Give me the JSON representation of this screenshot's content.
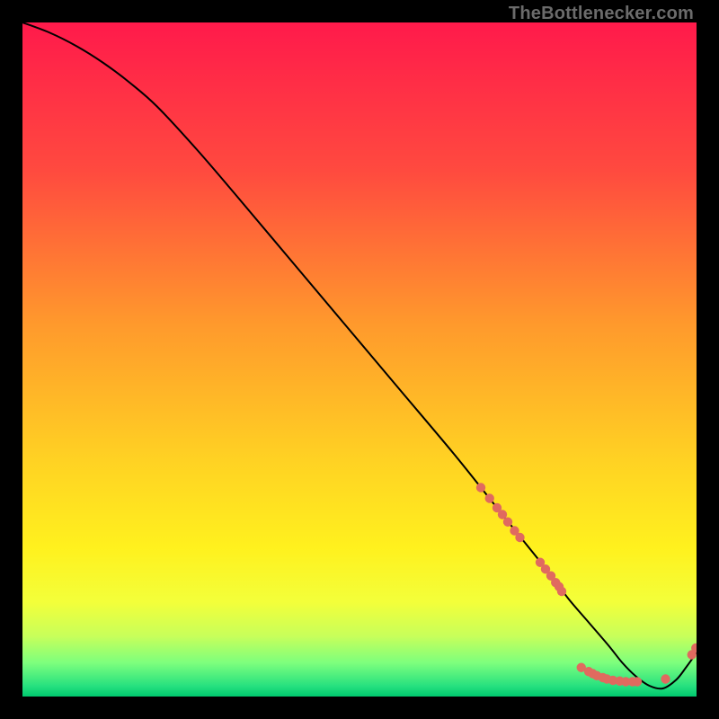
{
  "watermark": "TheBottlenecker.com",
  "chart_data": {
    "type": "line",
    "title": "",
    "xlabel": "",
    "ylabel": "",
    "xlim": [
      0,
      100
    ],
    "ylim": [
      0,
      100
    ],
    "grid": false,
    "legend": false,
    "background_gradient": {
      "stops": [
        {
          "offset": 0.0,
          "color": "#ff1a4b"
        },
        {
          "offset": 0.22,
          "color": "#ff4a3f"
        },
        {
          "offset": 0.45,
          "color": "#ff9a2c"
        },
        {
          "offset": 0.65,
          "color": "#ffd223"
        },
        {
          "offset": 0.78,
          "color": "#fff11e"
        },
        {
          "offset": 0.86,
          "color": "#f3ff3a"
        },
        {
          "offset": 0.91,
          "color": "#c8ff5a"
        },
        {
          "offset": 0.95,
          "color": "#7dff7d"
        },
        {
          "offset": 0.985,
          "color": "#25e07f"
        },
        {
          "offset": 1.0,
          "color": "#00c86e"
        }
      ]
    },
    "series": [
      {
        "name": "bottleneck-curve",
        "color": "#000000",
        "x": [
          0,
          4,
          8,
          12,
          16,
          20,
          26,
          32,
          40,
          48,
          56,
          64,
          70,
          74,
          78,
          81,
          84,
          87,
          89,
          91,
          93,
          95,
          97,
          98.5,
          100
        ],
        "y": [
          100,
          98.5,
          96.5,
          94,
          91,
          87.5,
          81,
          74,
          64.5,
          55,
          45.5,
          36,
          28.5,
          23.5,
          18.5,
          14.5,
          11,
          7.5,
          5,
          3,
          1.6,
          1.2,
          2.5,
          4.4,
          6.5
        ]
      }
    ],
    "scatter": {
      "name": "gpu-points",
      "color": "#e06a5f",
      "radius": 5.2,
      "points": [
        {
          "x": 68.0,
          "y": 31.0
        },
        {
          "x": 69.3,
          "y": 29.4
        },
        {
          "x": 70.4,
          "y": 28.0
        },
        {
          "x": 71.2,
          "y": 27.0
        },
        {
          "x": 72.0,
          "y": 25.9
        },
        {
          "x": 73.0,
          "y": 24.6
        },
        {
          "x": 73.8,
          "y": 23.6
        },
        {
          "x": 76.8,
          "y": 19.9
        },
        {
          "x": 77.6,
          "y": 18.9
        },
        {
          "x": 78.4,
          "y": 17.9
        },
        {
          "x": 79.1,
          "y": 16.9
        },
        {
          "x": 79.6,
          "y": 16.3
        },
        {
          "x": 80.0,
          "y": 15.6
        },
        {
          "x": 82.9,
          "y": 4.3
        },
        {
          "x": 84.0,
          "y": 3.7
        },
        {
          "x": 84.6,
          "y": 3.4
        },
        {
          "x": 85.2,
          "y": 3.1
        },
        {
          "x": 86.1,
          "y": 2.8
        },
        {
          "x": 86.7,
          "y": 2.6
        },
        {
          "x": 87.6,
          "y": 2.4
        },
        {
          "x": 88.6,
          "y": 2.3
        },
        {
          "x": 89.5,
          "y": 2.2
        },
        {
          "x": 90.5,
          "y": 2.2
        },
        {
          "x": 91.2,
          "y": 2.2
        },
        {
          "x": 95.4,
          "y": 2.6
        },
        {
          "x": 99.3,
          "y": 6.2
        },
        {
          "x": 99.9,
          "y": 7.2
        }
      ]
    }
  }
}
